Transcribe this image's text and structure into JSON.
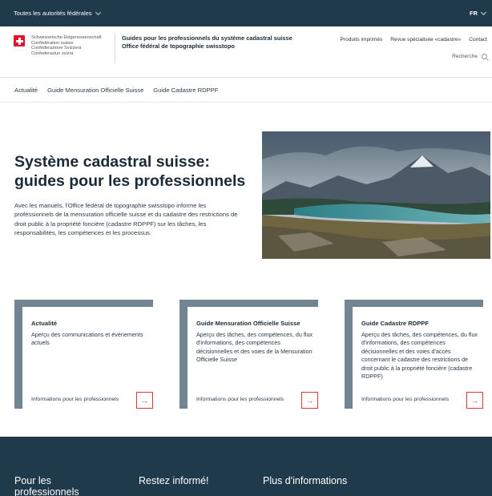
{
  "topbar": {
    "label": "Toutes les autorités fédérales",
    "lang": "FR"
  },
  "header": {
    "confederation": [
      "Schweizerische Eidgenossenschaft",
      "Confédération suisse",
      "Confederazione Svizzera",
      "Confederaziun svizra"
    ],
    "title_line1": "Guides pour les professionnels du système cadastral suisse",
    "title_line2": "Office fédéral de topographie swisstopo",
    "nav": [
      "Produits imprimés",
      "Revue spécialisée «cadastre»",
      "Contact"
    ],
    "search_label": "Recherche"
  },
  "mainnav": [
    "Actualité",
    "Guide Mensuration Officielle Suisse",
    "Guide Cadastre RDPPF"
  ],
  "hero": {
    "title": "Système cadastral suisse: guides pour les professionnels",
    "text": "Avec les manuels, l'Office fédéral de topographie swisstopo informe les professionnels de la mensuration officielle suisse et du cadastre des restrictions de droit public à la propriété foncière (cadastre RDPPF) sur les tâches, les responsabilités, les compétences et les processus."
  },
  "cards": [
    {
      "title": "Actualité",
      "text": "Aperçu des communications et événements actuels",
      "link": "Informations pour les professionnels"
    },
    {
      "title": "Guide Mensuration Officielle Suisse",
      "text": "Aperçu des tâches, des compétences, du flux d'informations, des compétences décisionnelles et des voies de la Mensuration Officielle Suisse",
      "link": "Informations pour les professionnels"
    },
    {
      "title": "Guide Cadastre RDPPF",
      "text": "Aperçu des tâches, des compétences, du flux d'informations, des compétences décisionnelles et des voies d'accès concernant le cadastre des restrictions de droit public à la propriété foncière (cadastre RDPPF)",
      "link": "Informations pour les professionnels"
    }
  ],
  "footer": [
    "Pour les professionnels",
    "Restez informé!",
    "Plus d'informations"
  ],
  "icons": {
    "arrow": "→"
  },
  "colors": {
    "dark": "#1f3a4a",
    "frame": "#718593",
    "accent": "#d9373b"
  }
}
